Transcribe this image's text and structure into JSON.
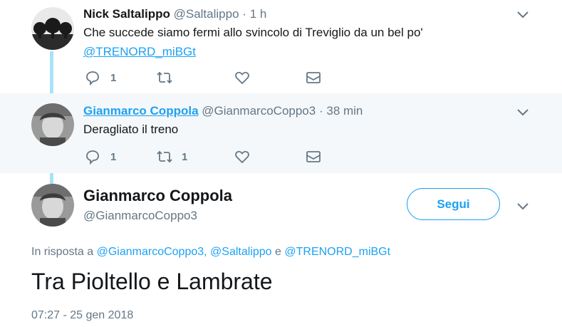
{
  "thread": [
    {
      "name": "Nick Saltalippo",
      "handle": "@Saltalippo",
      "separator": "·",
      "time": "1 h",
      "text": "Che succede siamo fermi allo svincolo di Treviglio da un bel po'",
      "mention": "@TRENORD_miBGt",
      "reply_count": "1",
      "retweet_count": "",
      "like_count": ""
    },
    {
      "name": "Gianmarco Coppola",
      "handle": "@GianmarcoCoppo3",
      "separator": "·",
      "time": "38 min",
      "text": "Deragliato il treno",
      "reply_count": "1",
      "retweet_count": "1",
      "like_count": ""
    }
  ],
  "main": {
    "name": "Gianmarco Coppola",
    "handle": "@GianmarcoCoppo3",
    "follow_label": "Segui",
    "reply_prefix": "In risposta a",
    "reply_mention_1": "@GianmarcoCoppo3,",
    "reply_mention_2": "@Saltalippo",
    "reply_conj": "e",
    "reply_mention_3": "@TRENORD_miBGt",
    "text": "Tra Pioltello e Lambrate",
    "timestamp": "07:27 - 25 gen 2018"
  },
  "colors": {
    "accent": "#1da1f2",
    "thread_line": "#a9e2f9",
    "muted": "#657786",
    "highlight_bg": "#f5f8fa"
  },
  "icons": [
    "reply-icon",
    "retweet-icon",
    "like-icon",
    "message-icon",
    "chevron-down-icon"
  ]
}
